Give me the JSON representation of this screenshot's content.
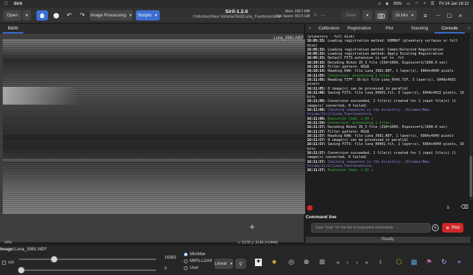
{
  "menubar": {
    "app_name": "Siril",
    "battery": "93%",
    "clock": "Fri 24 Jan  16:12"
  },
  "toolbar": {
    "open_label": "Open",
    "image_processing_label": "Image Processing",
    "scripts_label": "Scripts",
    "app_title": "Siril-1.2.6",
    "path": "/Volumes/New Volume/Siril/Luna_Fuerteventura",
    "mem": "Mem:  298.2 MiB",
    "disk": "Disk Space:  802.5 GiB",
    "save_label": "Save",
    "bits_label": "16 bits"
  },
  "left_tabs": {
    "bw": "B&W"
  },
  "image": {
    "filename_overlay": "Luna_3981.NEF",
    "zoom": "14%",
    "coords": "x: 5178  y: 3145 (=1444)"
  },
  "bottom": {
    "image_label": "Image:",
    "image_name": "Luna_3981.NEF",
    "max_value": "16383",
    "min_value": "0",
    "cut_label": "cut",
    "radio_minmax": "Min/Max",
    "radio_mips": "MIPS-LO/HI",
    "radio_user": "User",
    "stretch_label": "Linear"
  },
  "right_tabs": [
    "Calibration",
    "Registration",
    "Plot",
    "Stacking",
    "Console"
  ],
  "console": {
    "lines": [
      {
        "ts": "",
        "text": "(planetary - full disk)",
        "color": ""
      },
      {
        "ts": "16:05:33:",
        "text": " Loading registration method: KOMBAT (planetary surfaces or full disk)",
        "color": ""
      },
      {
        "ts": "16:05:33:",
        "text": " Loading registration method: Comet/Asteroid Registration",
        "color": ""
      },
      {
        "ts": "16:05:33:",
        "text": " Loading registration method: Apply Existing Registration",
        "color": ""
      },
      {
        "ts": "16:05:33:",
        "text": " Default FITS extension is set to .fit",
        "color": ""
      },
      {
        "ts": "16:10:18:",
        "text": " Decoding Nikon Z6_3 file (ISO=1000, Exposure=1/1600.0 sec)",
        "color": ""
      },
      {
        "ts": "16:10:18:",
        "text": " Filter pattern: RGGB",
        "color": ""
      },
      {
        "ts": "16:10:18:",
        "text": " Reading RAW: file Luna_3981.NEF, 1 layer(s), 6064x4040 pixels",
        "color": ""
      },
      {
        "ts": "16:11:03:",
        "text": " Conversion: processing 1 files...",
        "color": "green"
      },
      {
        "ts": "16:11:05:",
        "text": " Reading TIFF: 16-bit file Luna_0945.TIF, 3 layer(s), 6048x4032 pixels",
        "color": ""
      },
      {
        "ts": "16:11:05:",
        "text": " 8 image(s) can be processed in parallel",
        "color": ""
      },
      {
        "ts": "16:11:06:",
        "text": " Saving FITS: file luna_00001.fit, 3 layer(s), 6048x4032 pixels, 16 bits",
        "color": ""
      },
      {
        "ts": "16:11:06:",
        "text": " Conversion succeeded, 1 file(s) created for 1 input file(s) (1 image(s) converted, 0 failed)",
        "color": ""
      },
      {
        "ts": "16:11:06:",
        "text": " Checking sequences in the directory: /Volumes/New Volume/Siril/Luna_Fuerteventura.",
        "color": "purple"
      },
      {
        "ts": "16:11:06:",
        "text": " Execution time: 2.69 s",
        "color": "green"
      },
      {
        "ts": "16:11:54:",
        "text": " Conversion: processing 1 files...",
        "color": "green"
      },
      {
        "ts": "16:11:57:",
        "text": " Decoding Nikon Z6_3 file (ISO=1000, Exposure=1/1600.0 sec)",
        "color": ""
      },
      {
        "ts": "16:11:57:",
        "text": " Filter pattern: RGGB",
        "color": ""
      },
      {
        "ts": "16:11:57:",
        "text": " Reading RAW: file Luna_3981.NEF, 1 layer(s), 6064x4040 pixels",
        "color": ""
      },
      {
        "ts": "16:11:57:",
        "text": " 8 image(s) can be processed in parallel",
        "color": ""
      },
      {
        "ts": "16:11:57:",
        "text": " Saving FITS: file luna_00001.fit, 1 layer(s), 6064x4040 pixels, 16 bits",
        "color": ""
      },
      {
        "ts": "16:11:57:",
        "text": " Conversion succeeded, 1 file(s) created for 1 input file(s) (1 image(s) converted, 0 failed)",
        "color": ""
      },
      {
        "ts": "16:11:57:",
        "text": " Checking sequences in the directory: /Volumes/New Volume/Siril/Luna_Fuerteventura.",
        "color": "purple"
      },
      {
        "ts": "16:11:57:",
        "text": " Execution time: 1.02 s",
        "color": "green"
      }
    ]
  },
  "command": {
    "label": "Command line",
    "placeholder": "Type \"help\" for the list of supported commands",
    "stop_label": "Stop",
    "status": "Ready."
  },
  "colors": {
    "accent": "#3d6fd2",
    "stop_red": "#cf2727",
    "console_green": "#3fba3f",
    "console_purple": "#8c84e0"
  }
}
